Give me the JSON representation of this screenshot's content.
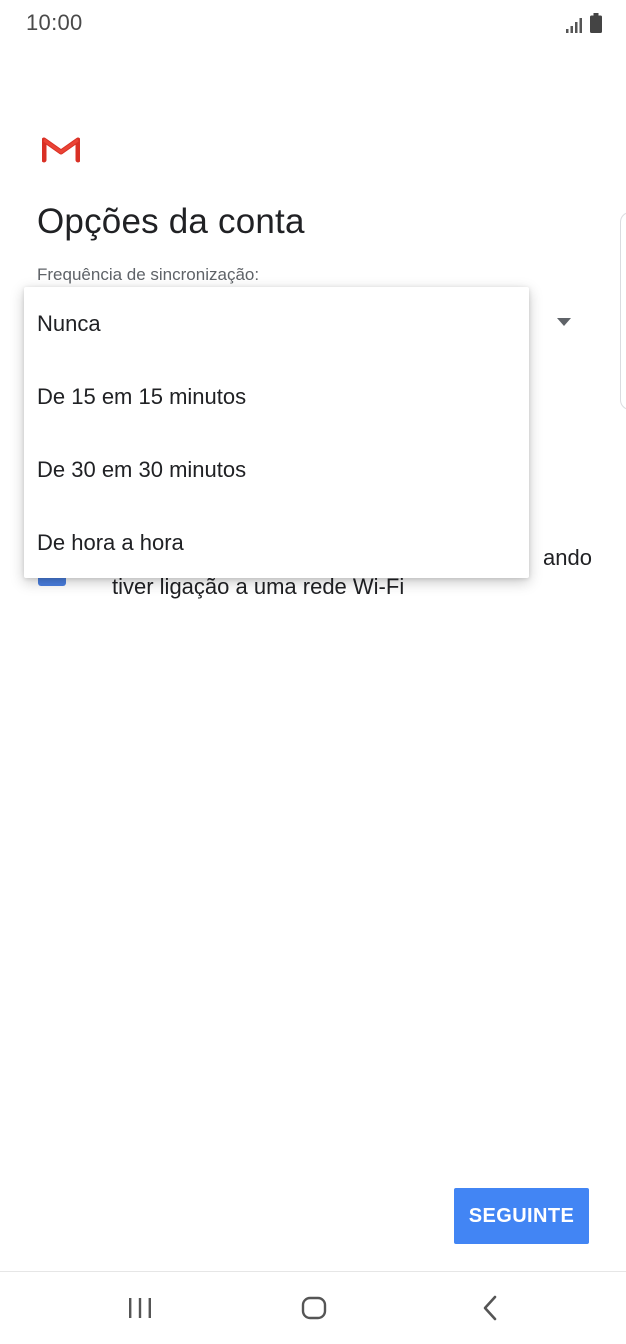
{
  "status_bar": {
    "time": "10:00",
    "icons": [
      "signal-icon",
      "battery-icon"
    ]
  },
  "app": {
    "logo": "gmail-logo"
  },
  "page": {
    "title": "Opções da conta",
    "sync_frequency_label": "Frequência de sincronização:"
  },
  "dropdown": {
    "options": [
      "Nunca",
      "De 15 em 15 minutos",
      "De 30 em 30 minutos",
      "De hora a hora"
    ]
  },
  "wifi_option": {
    "line1_visible_fragment": "ando",
    "line2": "tiver ligação a uma rede Wi-Fi",
    "checked": true
  },
  "actions": {
    "next_label": "SEGUINTE"
  },
  "nav_bar": {
    "buttons": [
      "recents-icon",
      "home-icon",
      "back-icon"
    ]
  },
  "colors": {
    "accent": "#4285f4",
    "gmail_red": "#d93025",
    "checkbox": "#4a7fe0"
  }
}
